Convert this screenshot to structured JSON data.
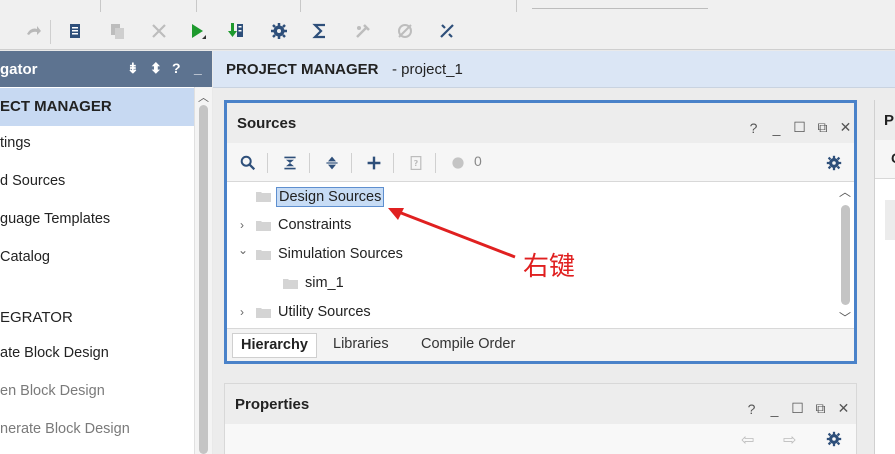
{
  "toolbar": {
    "icons": [
      "redo-icon",
      "report-icon",
      "copy-icon",
      "delete-icon",
      "run-icon",
      "download-icon",
      "settings-icon",
      "sigma-icon",
      "tools-icon",
      "disabled-icon",
      "cut-wire-icon"
    ]
  },
  "navigator": {
    "title": "gator",
    "sections": [
      {
        "label": "ECT MANAGER",
        "active": true
      },
      {
        "label": "EGRATOR",
        "active": false
      }
    ],
    "items": [
      {
        "label": "tings",
        "dim": false
      },
      {
        "label": "d Sources",
        "dim": false
      },
      {
        "label": "guage Templates",
        "dim": false
      },
      {
        "label": "Catalog",
        "dim": false
      },
      {
        "label": "ate Block Design",
        "dim": false
      },
      {
        "label": "en Block Design",
        "dim": true
      },
      {
        "label": "nerate Block Design",
        "dim": true
      }
    ]
  },
  "project_header": {
    "title": "PROJECT MANAGER",
    "subtitle": "- project_1"
  },
  "sources_panel": {
    "title": "Sources",
    "count": "0",
    "tree": [
      {
        "label": "Design Sources",
        "expander": "",
        "selected": true,
        "indent": 0
      },
      {
        "label": "Constraints",
        "expander": "›",
        "selected": false,
        "indent": 0
      },
      {
        "label": "Simulation Sources",
        "expander": "⌄",
        "selected": false,
        "indent": 0
      },
      {
        "label": "sim_1",
        "expander": "",
        "selected": false,
        "indent": 1
      },
      {
        "label": "Utility Sources",
        "expander": "›",
        "selected": false,
        "indent": 0
      }
    ],
    "tabs": [
      "Hierarchy",
      "Libraries",
      "Compile Order"
    ],
    "active_tab": "Hierarchy"
  },
  "properties_panel": {
    "title": "Properties"
  },
  "right_panel": {
    "title": "P",
    "sub": "C"
  },
  "annotation": {
    "text": "右键",
    "color": "#e02020"
  }
}
